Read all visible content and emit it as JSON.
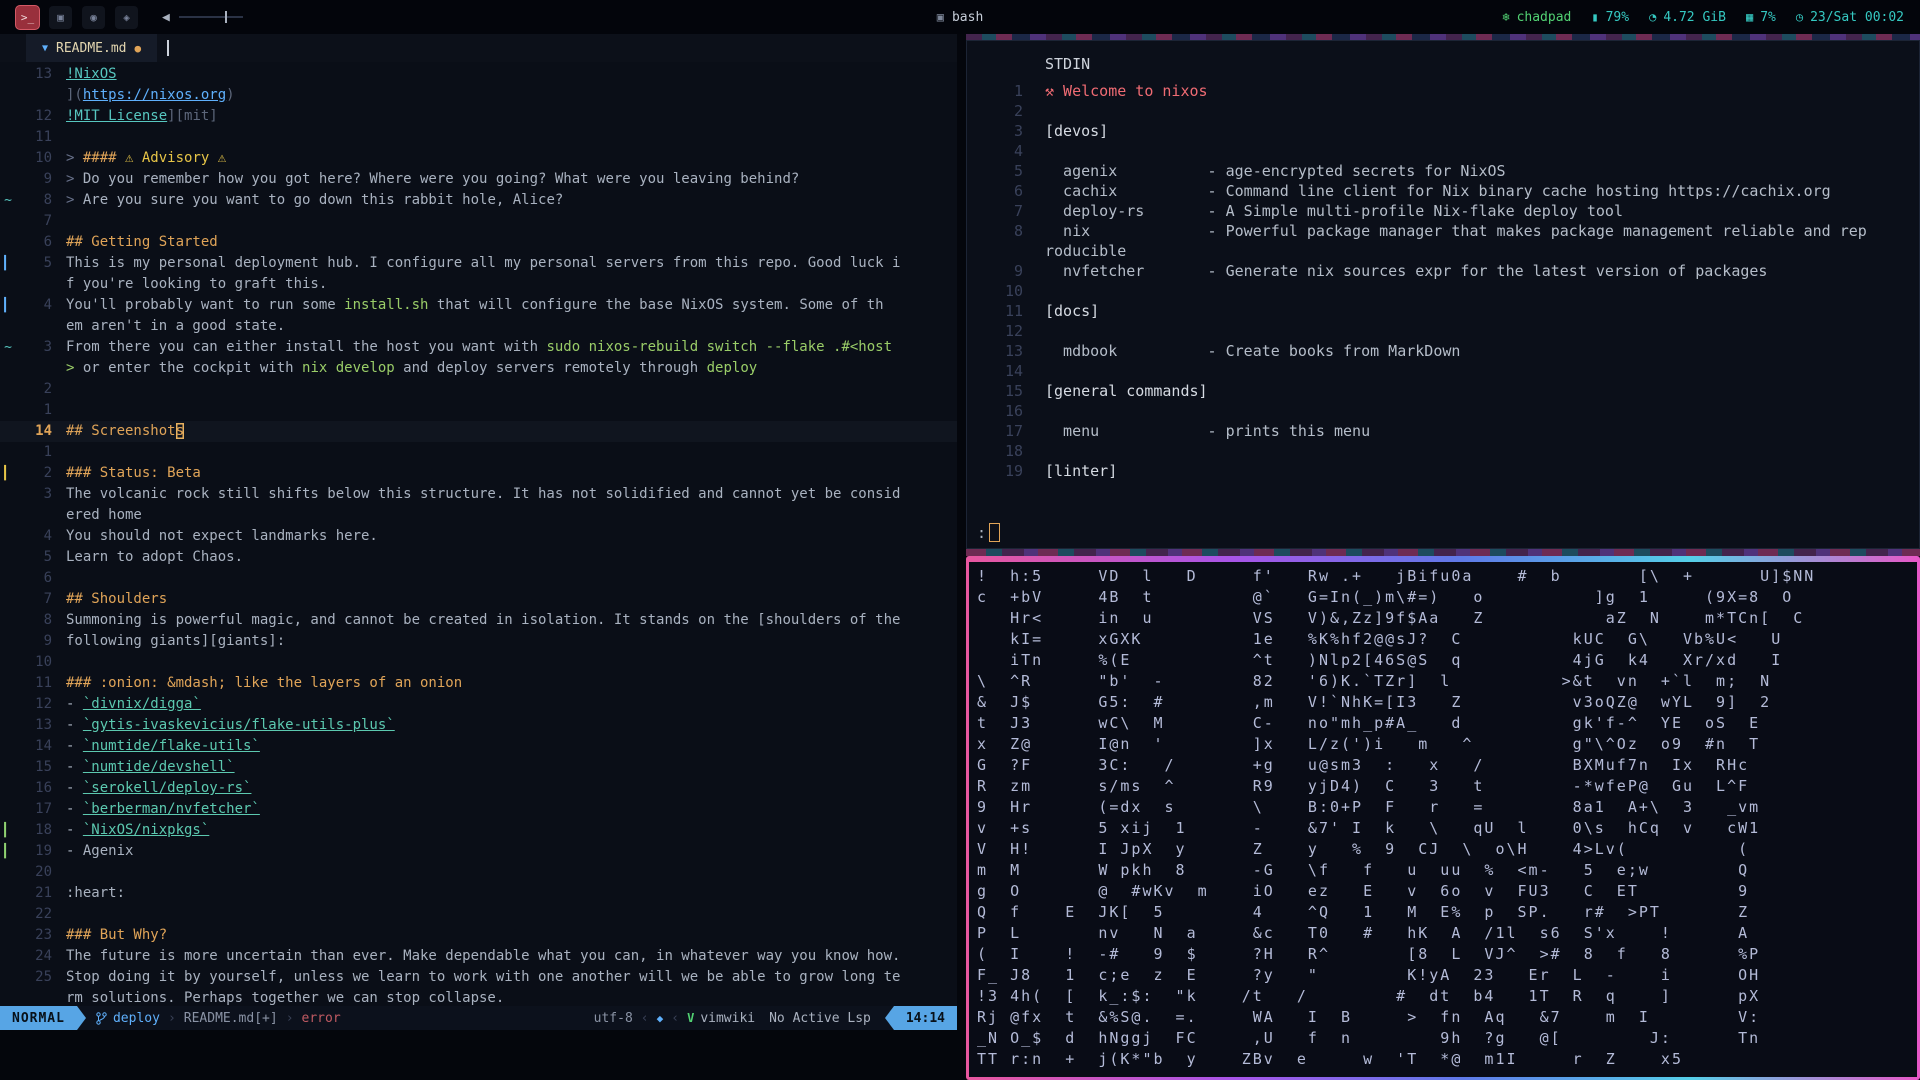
{
  "topbar": {
    "workspaces": [
      {
        "name": "terminal",
        "glyph": ">_",
        "active": true
      },
      {
        "name": "chat",
        "glyph": "▣",
        "active": false
      },
      {
        "name": "ghost",
        "glyph": "◉",
        "active": false
      },
      {
        "name": "apps",
        "glyph": "◈",
        "active": false
      }
    ],
    "volume_icon": "◀",
    "window_icon": "▣",
    "window_title": "bash",
    "status": [
      {
        "name": "host",
        "icon": "❄",
        "text": "chadpad",
        "color": "green"
      },
      {
        "name": "battery",
        "icon": "▮",
        "text": "79%",
        "color": "teal"
      },
      {
        "name": "memory",
        "icon": "◔",
        "text": "4.72 GiB",
        "color": "teal"
      },
      {
        "name": "cpu",
        "icon": "▦",
        "text": "7%",
        "color": "teal"
      },
      {
        "name": "clock",
        "icon": "◷",
        "text": "23/Sat 00:02",
        "color": "teal"
      }
    ]
  },
  "editor": {
    "tab": {
      "icon": "▼",
      "filename": "README.md",
      "modified_dot": "●"
    },
    "lines": [
      {
        "n": "13",
        "segs": [
          {
            "t": "!NixOS",
            "c": "link"
          }
        ]
      },
      {
        "n": "",
        "segs": [
          {
            "t": "](",
            "c": "punct"
          },
          {
            "t": "https://nixos.org",
            "c": "url"
          },
          {
            "t": ")",
            "c": "punct"
          }
        ]
      },
      {
        "n": "12",
        "segs": [
          {
            "t": "!MIT License",
            "c": "link"
          },
          {
            "t": "][mit]",
            "c": "punct"
          }
        ]
      },
      {
        "n": "11",
        "segs": []
      },
      {
        "n": "10",
        "segs": [
          {
            "t": "> ",
            "c": "quote"
          },
          {
            "t": "#### ",
            "c": "head"
          },
          {
            "t": "⚠ Advisory ⚠",
            "c": "warn"
          }
        ]
      },
      {
        "n": "9",
        "segs": [
          {
            "t": "> ",
            "c": "quote"
          },
          {
            "t": "Do you remember how you got here? Where were you going? What were you leaving behind?",
            "c": "fg"
          }
        ]
      },
      {
        "n": "8",
        "sign": "~",
        "signcls": "scyan",
        "segs": [
          {
            "t": "> ",
            "c": "quote"
          },
          {
            "t": "Are you sure you want to go down this rabbit hole, Alice?",
            "c": "fg"
          }
        ]
      },
      {
        "n": "7",
        "segs": []
      },
      {
        "n": "6",
        "segs": [
          {
            "t": "## Getting Started",
            "c": "head"
          }
        ]
      },
      {
        "n": "5",
        "sign": "▎",
        "signcls": "sblue",
        "segs": [
          {
            "t": "This is my personal deployment hub. I configure all my personal servers from this repo. Good luck i",
            "c": "fg"
          }
        ]
      },
      {
        "n": "",
        "segs": [
          {
            "t": "f you're looking to graft this.",
            "c": "fg"
          }
        ]
      },
      {
        "n": "4",
        "sign": "▎",
        "signcls": "sblue",
        "segs": [
          {
            "t": "You'll probably want to run some ",
            "c": "fg"
          },
          {
            "t": "install.sh",
            "c": "code"
          },
          {
            "t": " that will configure the base NixOS system. Some of th",
            "c": "fg"
          }
        ]
      },
      {
        "n": "",
        "segs": [
          {
            "t": "em aren't in a good state.",
            "c": "fg"
          }
        ]
      },
      {
        "n": "3",
        "sign": "~",
        "signcls": "scyan",
        "segs": [
          {
            "t": "From there you can either install the host you want with ",
            "c": "fg"
          },
          {
            "t": "sudo nixos-rebuild switch --flake .#<host",
            "c": "code"
          }
        ]
      },
      {
        "n": "",
        "segs": [
          {
            "t": ">",
            "c": "code"
          },
          {
            "t": " or enter the cockpit with ",
            "c": "fg"
          },
          {
            "t": "nix develop",
            "c": "code"
          },
          {
            "t": " and deploy servers remotely through ",
            "c": "fg"
          },
          {
            "t": "deploy",
            "c": "code"
          }
        ]
      },
      {
        "n": "2",
        "segs": []
      },
      {
        "n": "1",
        "segs": []
      },
      {
        "n": "14",
        "cur": true,
        "segs": [
          {
            "t": "## Screenshot",
            "c": "head"
          },
          {
            "t": "s",
            "c": "head cursor"
          }
        ]
      },
      {
        "n": "1",
        "segs": []
      },
      {
        "n": "2",
        "sign": "▎",
        "signcls": "syellow",
        "segs": [
          {
            "t": "### Status: Beta",
            "c": "head"
          }
        ]
      },
      {
        "n": "3",
        "segs": [
          {
            "t": "The volcanic rock still shifts below this structure. It has not solidified and cannot yet be consid",
            "c": "fg"
          }
        ]
      },
      {
        "n": "",
        "segs": [
          {
            "t": "ered home",
            "c": "fg"
          }
        ]
      },
      {
        "n": "4",
        "segs": [
          {
            "t": "You should not expect landmarks here.",
            "c": "fg"
          }
        ]
      },
      {
        "n": "5",
        "segs": [
          {
            "t": "Learn to adopt Chaos.",
            "c": "fg"
          }
        ]
      },
      {
        "n": "6",
        "segs": []
      },
      {
        "n": "7",
        "segs": [
          {
            "t": "## Shoulders",
            "c": "head"
          }
        ]
      },
      {
        "n": "8",
        "segs": [
          {
            "t": "Summoning is powerful magic, and cannot be created in isolation. It stands on the [shoulders of the",
            "c": "fg"
          }
        ]
      },
      {
        "n": "9",
        "segs": [
          {
            "t": "following giants][giants]:",
            "c": "fg"
          }
        ]
      },
      {
        "n": "10",
        "segs": []
      },
      {
        "n": "11",
        "segs": [
          {
            "t": "### :onion: &mdash; like the layers of an onion",
            "c": "head"
          }
        ]
      },
      {
        "n": "12",
        "segs": [
          {
            "t": "- ",
            "c": "fg"
          },
          {
            "t": "`divnix/digga`",
            "c": "codelink"
          }
        ]
      },
      {
        "n": "13",
        "segs": [
          {
            "t": "- ",
            "c": "fg"
          },
          {
            "t": "`gytis-ivaskevicius/flake-utils-plus`",
            "c": "codelink"
          }
        ]
      },
      {
        "n": "14",
        "segs": [
          {
            "t": "- ",
            "c": "fg"
          },
          {
            "t": "`numtide/flake-utils`",
            "c": "codelink"
          }
        ]
      },
      {
        "n": "15",
        "segs": [
          {
            "t": "- ",
            "c": "fg"
          },
          {
            "t": "`numtide/devshell`",
            "c": "codelink"
          }
        ]
      },
      {
        "n": "16",
        "segs": [
          {
            "t": "- ",
            "c": "fg"
          },
          {
            "t": "`serokell/deploy-rs`",
            "c": "codelink"
          }
        ]
      },
      {
        "n": "17",
        "segs": [
          {
            "t": "- ",
            "c": "fg"
          },
          {
            "t": "`berberman/nvfetcher`",
            "c": "codelink"
          }
        ]
      },
      {
        "n": "18",
        "sign": "▎",
        "signcls": "sgreen",
        "segs": [
          {
            "t": "- ",
            "c": "fg"
          },
          {
            "t": "`NixOS/nixpkgs`",
            "c": "codelink"
          }
        ]
      },
      {
        "n": "19",
        "sign": "▎",
        "signcls": "sgreen",
        "segs": [
          {
            "t": "- Agenix",
            "c": "fg"
          }
        ]
      },
      {
        "n": "20",
        "segs": []
      },
      {
        "n": "21",
        "segs": [
          {
            "t": ":heart:",
            "c": "fg"
          }
        ]
      },
      {
        "n": "22",
        "segs": []
      },
      {
        "n": "23",
        "segs": [
          {
            "t": "### But Why?",
            "c": "head"
          }
        ]
      },
      {
        "n": "24",
        "segs": [
          {
            "t": "The future is more uncertain than ever. Make dependable what you can, in whatever way you know how.",
            "c": "fg"
          }
        ]
      },
      {
        "n": "25",
        "segs": [
          {
            "t": "Stop doing it by yourself, unless we learn to work with one another will we be able to grow long te",
            "c": "fg"
          }
        ]
      },
      {
        "n": "",
        "segs": [
          {
            "t": "rm solutions. Perhaps together we can stop collapse.",
            "c": "fg"
          }
        ]
      }
    ],
    "statusline": {
      "mode": "NORMAL",
      "branch": "deploy",
      "sep": "›",
      "file": "README.md[+]",
      "diag": "error",
      "encoding": "utf-8",
      "rsep": "‹",
      "os_icon": "◆",
      "vim_icon": "V",
      "filetype": "vimwiki",
      "lsp": "No Active Lsp",
      "position": "14:14"
    }
  },
  "pager": {
    "header": "STDIN",
    "prompt": ":",
    "lines": [
      {
        "n": "1",
        "cls": "welcome",
        "text": "⚒ Welcome to nixos"
      },
      {
        "n": "2",
        "text": ""
      },
      {
        "n": "3",
        "cls": "section",
        "text": "[devos]"
      },
      {
        "n": "4",
        "text": ""
      },
      {
        "n": "5",
        "text": "  agenix          - age-encrypted secrets for NixOS"
      },
      {
        "n": "6",
        "text": "  cachix          - Command line client for Nix binary cache hosting https://cachix.org"
      },
      {
        "n": "7",
        "text": "  deploy-rs       - A Simple multi-profile Nix-flake deploy tool"
      },
      {
        "n": "8",
        "text": "  nix             - Powerful package manager that makes package management reliable and rep"
      },
      {
        "n": "",
        "text": "roducible"
      },
      {
        "n": "9",
        "text": "  nvfetcher       - Generate nix sources expr for the latest version of packages"
      },
      {
        "n": "10",
        "text": ""
      },
      {
        "n": "11",
        "cls": "section",
        "text": "[docs]"
      },
      {
        "n": "12",
        "text": ""
      },
      {
        "n": "13",
        "text": "  mdbook          - Create books from MarkDown"
      },
      {
        "n": "14",
        "text": ""
      },
      {
        "n": "15",
        "cls": "section",
        "text": "[general commands]"
      },
      {
        "n": "16",
        "text": ""
      },
      {
        "n": "17",
        "text": "  menu            - prints this menu"
      },
      {
        "n": "18",
        "text": ""
      },
      {
        "n": "19",
        "cls": "section",
        "text": "[linter]"
      }
    ]
  },
  "matrix": {
    "rows": [
      "!  h:5     VD  l   D     f'   Rw .+   jBifu0a    #  b       [\\  +      U]$NN",
      "c  +bV     4B  t         @`   G=In(_)m\\#=)   o          ]g  1     (9X=8  O",
      "   Hr<     in  u         VS   V)&,Zz]9f$Aa   Z           aZ  N    m*TCn[  C",
      "   kI=     xGXK          1e   %K%hf2@@sJ?  C          kUC  G\\   Vb%U<   U",
      "   iTn     %(E           ^t   )Nlp2[46S@S  q          4jG  k4   Xr/xd   I",
      "\\  ^R      \"b'  -        82   '6)K.`TZr]  l          >&t  vn  +`l  m;  N",
      "&  J$      G5:  #        ,m   V!`NhK=[I3   Z          v3oQZ@  wYL  9]  2",
      "t  J3      wC\\  M        C-   no\"mh_p#A_   d          gk'f-^  YE  oS  E",
      "x  Z@      I@n  '        ]x   L/z(')i   m   ^         g\"\\^Oz  o9  #n  T",
      "G  ?F      3C:   /       +g   u@sm3  :   x   /        BXMuf7n  Ix  RHc",
      "R  zm      s/ms  ^       R9   yjD4)  C   3   t        -*wfeP@  Gu  L^F",
      "9  Hr      (=dx  s       \\    B:0+P  F   r   =        8a1  A+\\  3   _vm",
      "v  +s      5 xij  1      -    &7' I  k   \\   qU  l    0\\s  hCq  v   cW1",
      "V  H!      I JpX  y      Z    y   %  9  CJ  \\  o\\H    4>Lv(          (",
      "m  M       W pkh  8      -G   \\f   f   u  uu  %  <m-   5  e;w        Q",
      "g  O       @  #wKv  m    iO   ez   E   v  6o  v  FU3   C  ET         9",
      "Q  f    E  JK[  5        4    ^Q   1   M  E%  p  SP.   r#  >PT       Z",
      "P  L       nv   N  a     &c   T0   #   hK  A  /1l  s6  S'x    !      A",
      "(  I    !  -#   9  $     ?H   R^       [8  L  VJ^  >#  8  f   8      %P",
      "F_ J8   1  c;e  z  E     ?y   \"        K!yA  23   Er  L  -    i      OH",
      "!3 4h(  [  k_:$:  \"k    /t   /        #  dt  b4   1T  R  q    ]      pX",
      "Rj @fx  t  &%S@.  =.     WA   I  B     >  fn  Aq   &7    m  I        V:",
      "_N O_$  d  hNggj  FC     ,U   f  n        9h  ?g   @[        J:      Tn",
      "TT r:n  +  j(K*\"b  y    ZBv  e     w  'T  *@  m1I     r  Z    x5"
    ]
  }
}
